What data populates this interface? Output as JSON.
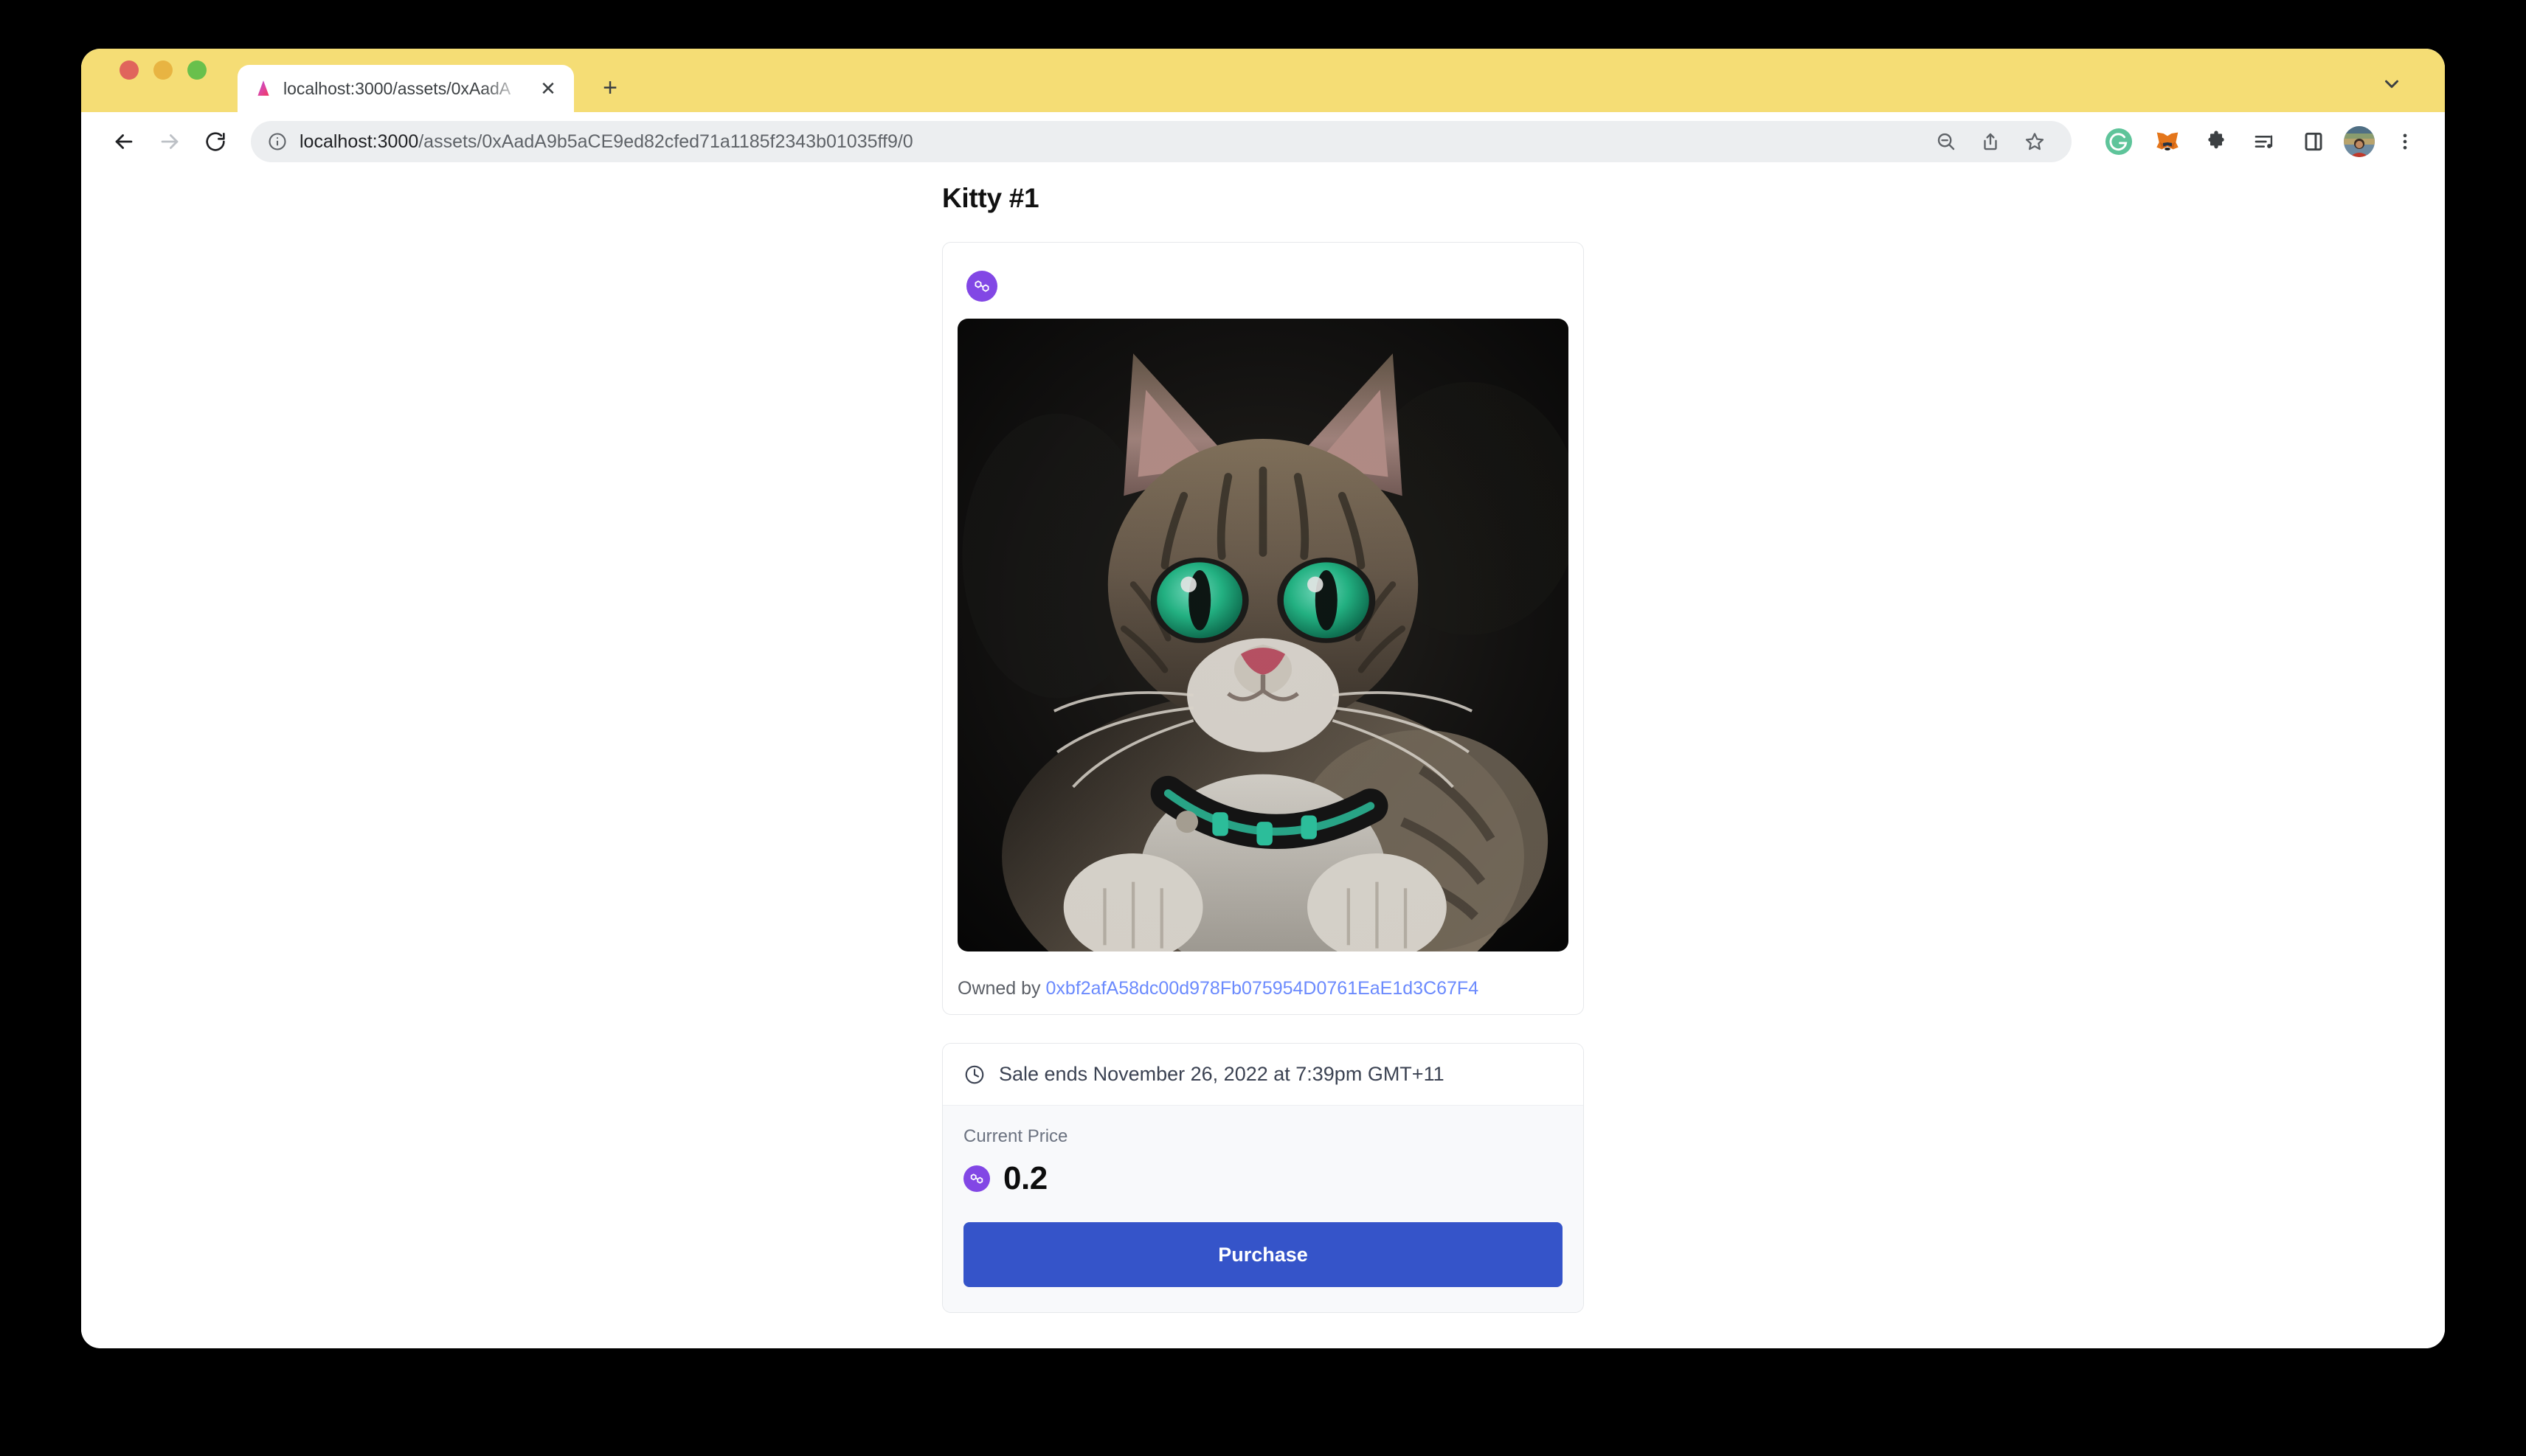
{
  "browser": {
    "tab": {
      "title": "localhost:3000/assets/0xAadA",
      "favicon_icon": "nextjs-triangle-icon",
      "close_icon": "close-icon"
    },
    "new_tab_label": "+",
    "tabstrip_chevron_icon": "chevron-down-icon",
    "window_controls": {
      "close_color": "#e0655c",
      "minimize_color": "#e8b442",
      "maximize_color": "#69c04c"
    },
    "tabstrip_color": "#f5dd75",
    "nav": {
      "back_icon": "back-arrow-icon",
      "forward_icon": "forward-arrow-icon",
      "reload_icon": "reload-icon"
    },
    "omnibox": {
      "info_icon": "site-info-icon",
      "url_host": "localhost:3000",
      "url_path": "/assets/0xAadA9b5aCE9ed82cfed71a1185f2343b01035ff9/0",
      "full_url": "localhost:3000/assets/0xAadA9b5aCE9ed82cfed71a1185f2343b01035ff9/0",
      "zoom_out_icon": "zoom-out-icon",
      "share_icon": "share-icon",
      "bookmark_icon": "bookmark-star-icon"
    },
    "extensions": [
      {
        "name": "grammarly-icon",
        "label": "G",
        "color": "#5ec49a"
      },
      {
        "name": "metamask-fox-icon",
        "color": "#e2761b"
      },
      {
        "name": "extensions-puzzle-icon",
        "color": "#3c4043"
      },
      {
        "name": "reading-list-icon",
        "color": "#3c4043"
      },
      {
        "name": "side-panel-icon",
        "color": "#3c4043"
      }
    ],
    "profile_avatar_icon": "profile-avatar",
    "menu_icon": "three-dot-menu-icon"
  },
  "page": {
    "title": "Kitty #1",
    "asset": {
      "chain_badge_icon": "polygon-icon",
      "chain_badge_color": "#8247e5",
      "image_alt": "tabby cat with green eyes wearing teal collar",
      "owner_prefix": "Owned by",
      "owner_address": "0xbf2afA58dc00d978Fb075954D0761EaE1d3C67F4",
      "owner_link_color": "#6b8afd"
    },
    "sale": {
      "clock_icon": "clock-icon",
      "sale_ends_text": "Sale ends November 26, 2022 at 7:39pm GMT+11",
      "price_label": "Current Price",
      "price_currency_icon": "polygon-icon",
      "price_value": "0.2",
      "purchase_label": "Purchase",
      "purchase_color": "#3554c9"
    }
  }
}
